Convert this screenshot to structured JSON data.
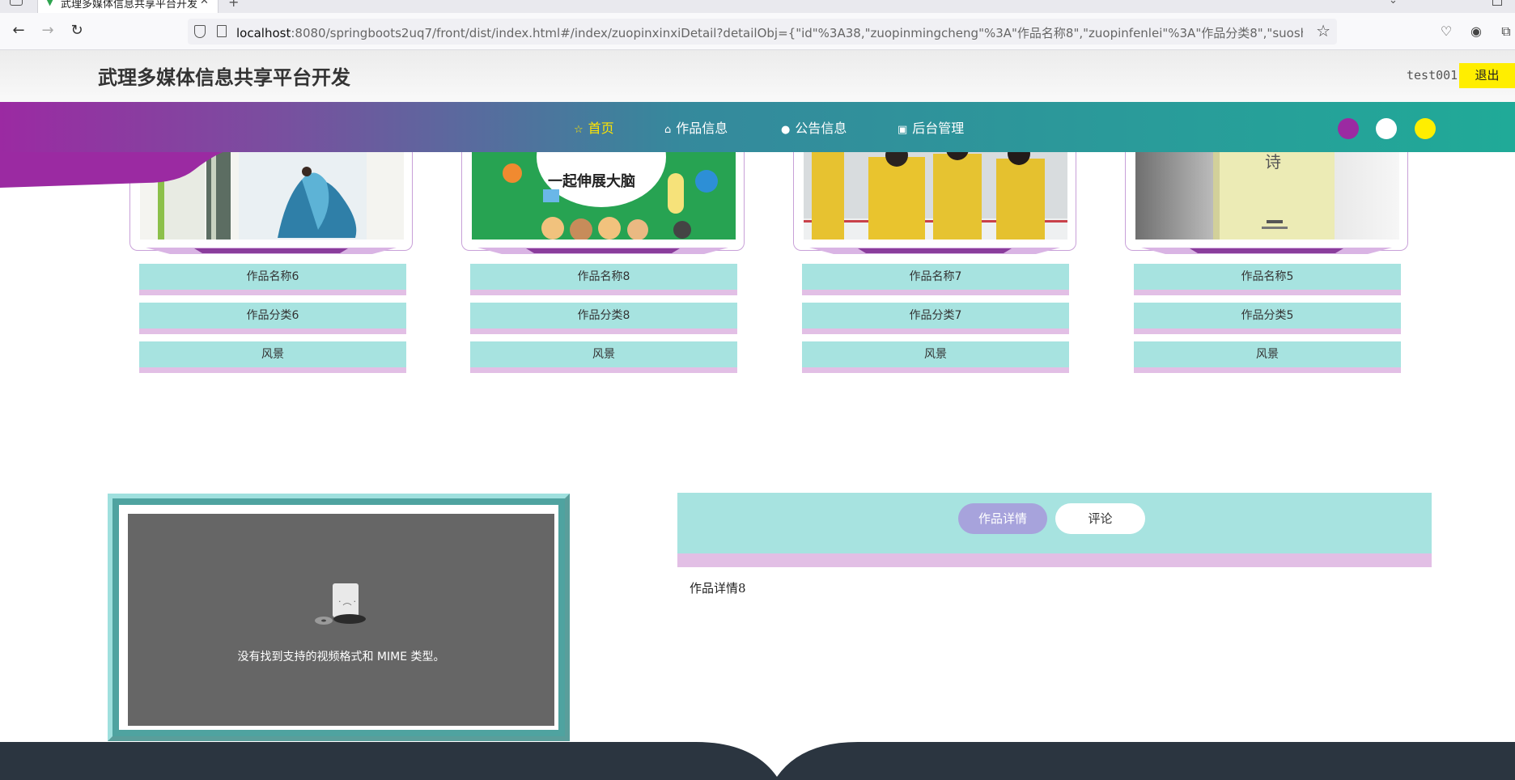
{
  "browser": {
    "tab_title": "武理多媒体信息共享平台开发",
    "url_host": "localhost",
    "url_rest": ":8080/springboots2uq7/front/dist/index.html#/index/zuopinxinxiDetail?detailObj={\"id\"%3A38,\"zuopinmingcheng\"%3A\"作品名称8\",\"zuopinfenlei\"%3A\"作品分类8\",\"suoshuleibie\"%3A\"风景\",\"zuo"
  },
  "header": {
    "title": "武理多媒体信息共享平台开发",
    "username": "test001",
    "logout_label": "退出"
  },
  "nav": {
    "items": [
      {
        "label": "首页",
        "icon": "star-icon",
        "active": true
      },
      {
        "label": "作品信息",
        "icon": "home-icon",
        "active": false
      },
      {
        "label": "公告信息",
        "icon": "info-icon",
        "active": false
      },
      {
        "label": "后台管理",
        "icon": "briefcase-icon",
        "active": false
      }
    ],
    "theme_colors": [
      "#9b2aa2",
      "#ffffff",
      "#ffee00"
    ]
  },
  "works": [
    {
      "name": "作品名称6",
      "category": "作品分类6",
      "type": "风景"
    },
    {
      "name": "作品名称8",
      "category": "作品分类8",
      "type": "风景"
    },
    {
      "name": "作品名称7",
      "category": "作品分类7",
      "type": "风景"
    },
    {
      "name": "作品名称5",
      "category": "作品分类5",
      "type": "风景"
    }
  ],
  "video": {
    "error_text": "没有找到支持的视频格式和 MIME 类型。"
  },
  "thumb_text": {
    "w2_sub": "一起伸展大脑",
    "w4_title": "诗"
  },
  "detail": {
    "tab_detail": "作品详情",
    "tab_comment": "评论",
    "content": "作品详情8"
  },
  "colors": {
    "field_bg": "#a7e3e0",
    "field_border": "#e2bfe5",
    "tab_active": "#a7a3dc",
    "footer": "#2b3540"
  }
}
